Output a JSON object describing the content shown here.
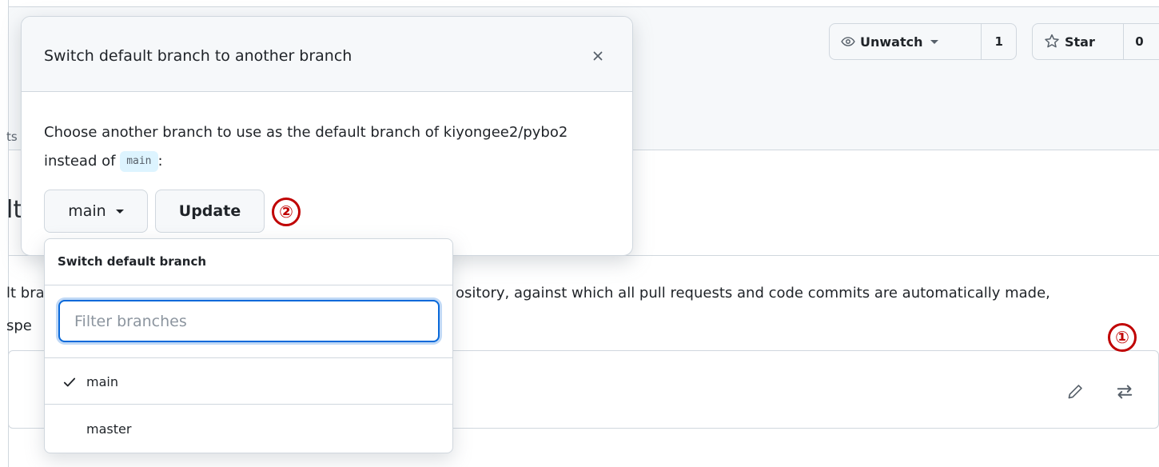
{
  "repo_header": {
    "nav_fragment": "ts",
    "watch_label": "Unwatch",
    "watch_count": "1",
    "star_label": "Star",
    "star_count": "0"
  },
  "page": {
    "heading_fragment": "lt",
    "description_fragment_1": "lt bra",
    "description_fragment_2": "ository, against which all pull requests and code commits are automatically made,",
    "description_fragment_3": "spe"
  },
  "branch_box": {
    "edit_icon": "pencil-icon",
    "switch_icon": "arrow-switch-icon"
  },
  "dialog": {
    "title": "Switch default branch to another branch",
    "close_icon": "close-icon",
    "body_text": "Choose another branch to use as the default branch of kiyongee2/pybo2 instead of",
    "current_branch": "main",
    "body_suffix": ":",
    "branch_select_label": "main",
    "update_label": "Update"
  },
  "dropdown": {
    "title": "Switch default branch",
    "filter_placeholder": "Filter branches",
    "filter_value": "",
    "branches": [
      {
        "name": "main",
        "selected": true
      },
      {
        "name": "master",
        "selected": false
      }
    ]
  },
  "annotations": {
    "marker_1": "①",
    "marker_2": "②"
  },
  "colors": {
    "accent": "#0969da",
    "marker_red": "#c00000",
    "header_bg": "#f6f8fa",
    "border": "#d0d7de",
    "code_chip_bg": "#ddf4ff"
  }
}
